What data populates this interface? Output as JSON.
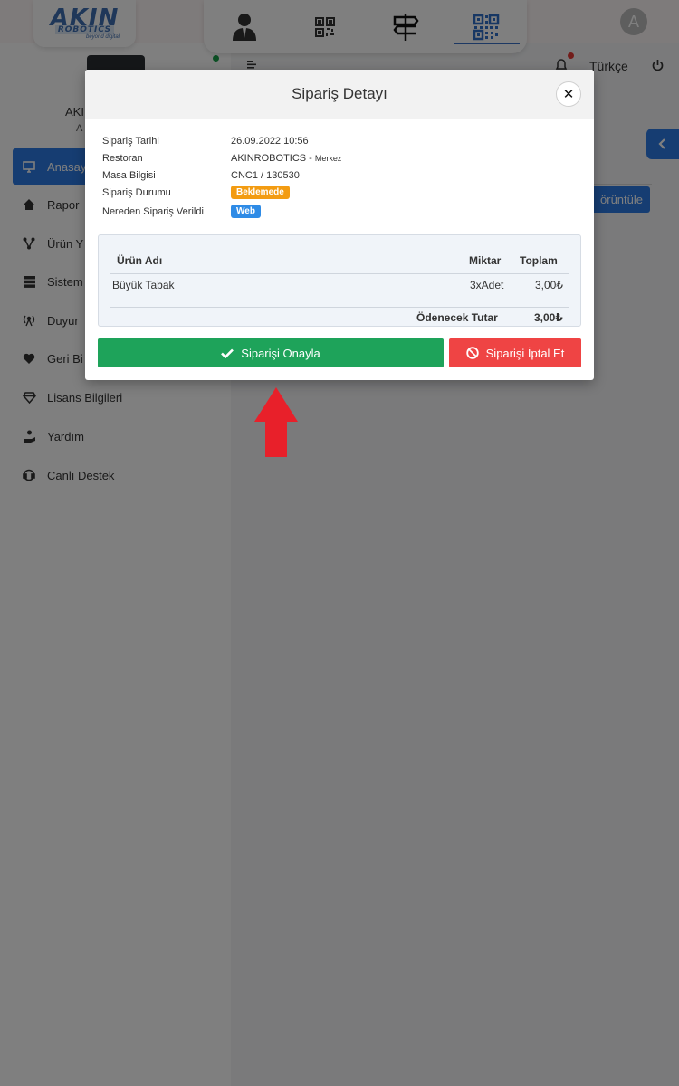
{
  "header": {
    "logo_top": "AKIN",
    "logo_bottom": "ROBOTICS",
    "logo_tagline": "beyond digital",
    "tabs": [
      {
        "icon": "user-icon"
      },
      {
        "icon": "qr-grid-icon"
      },
      {
        "icon": "signpost-icon"
      },
      {
        "icon": "qr-code-icon",
        "active": true
      }
    ],
    "avatar_letter": "A"
  },
  "sidebar": {
    "profile_name": "AKI",
    "profile_sub": "A",
    "items": [
      {
        "label": "Anasay",
        "icon": "monitor-icon",
        "active": true
      },
      {
        "label": "Rapor",
        "icon": "report-icon"
      },
      {
        "label": "Ürün Y",
        "icon": "network-icon"
      },
      {
        "label": "Sistem",
        "icon": "database-icon"
      },
      {
        "label": "Duyur",
        "icon": "broadcast-icon"
      },
      {
        "label": "Geri Bi",
        "icon": "heart-pulse-icon"
      },
      {
        "label": "Lisans Bilgileri",
        "icon": "diamond-icon"
      },
      {
        "label": "Yardım",
        "icon": "hand-help-icon"
      },
      {
        "label": "Canlı Destek",
        "icon": "headset-icon"
      }
    ]
  },
  "main": {
    "language": "Türkçe",
    "view_button": "örüntüle"
  },
  "modal": {
    "title": "Sipariş Detayı",
    "info": {
      "date_label": "Sipariş Tarihi",
      "date_value": "26.09.2022 10:56",
      "restaurant_label": "Restoran",
      "restaurant_value": "AKINROBOTICS - ",
      "restaurant_branch": "Merkez",
      "table_label": "Masa Bilgisi",
      "table_value": "CNC1 / 130530",
      "status_label": "Sipariş Durumu",
      "status_value": "Beklemede",
      "source_label": "Nereden Sipariş Verildi",
      "source_value": "Web"
    },
    "table": {
      "col_product": "Ürün Adı",
      "col_quantity": "Miktar",
      "col_total": "Toplam",
      "rows": [
        {
          "product": "Büyük Tabak",
          "quantity": "3xAdet",
          "total": "3,00₺"
        }
      ],
      "footer_label": "Ödenecek Tutar",
      "footer_total": "3,00₺"
    },
    "confirm_button": "Siparişi Onayla",
    "cancel_button": "Siparişi İptal Et"
  },
  "colors": {
    "primary": "#2c7be5",
    "confirm": "#1ea35a",
    "cancel": "#ef4444",
    "badge_waiting": "#f39c12",
    "badge_web": "#2e8be6",
    "arrow": "#e8202a"
  }
}
